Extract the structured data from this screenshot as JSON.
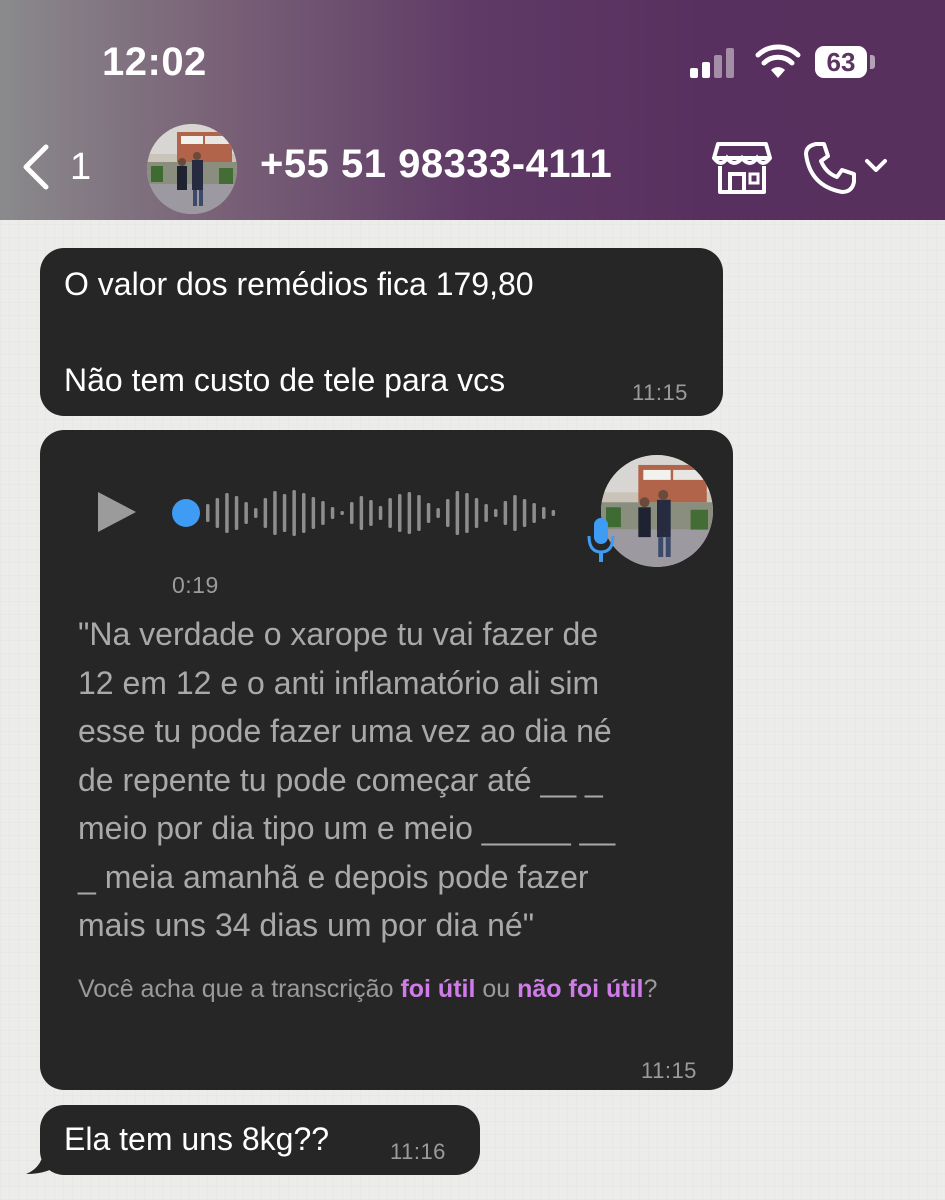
{
  "status_bar": {
    "time": "12:02",
    "battery": "63"
  },
  "header": {
    "back_count": "1",
    "contact": "+55 51 98333-4111"
  },
  "messages": [
    {
      "text": "O valor dos remédios fica 179,80\n\nNão tem custo de tele para vcs",
      "time": "11:15"
    },
    {
      "audio_duration": "0:19",
      "transcript": "\"Na verdade o xarope tu vai fazer de\n12 em 12 e o anti inflamatório ali sim\nesse tu pode fazer uma vez ao dia né\nde repente tu pode começar até __ _\nmeio por dia tipo um e meio _____ __\n_ meia amanhã e depois pode fazer\nmais uns 34 dias um por dia né\"",
      "feedback_prefix": "Você acha que a transcrição ",
      "feedback_yes": "foi útil",
      "feedback_mid": " ou ",
      "feedback_no": "não foi útil",
      "feedback_suffix": "?",
      "time": "11:15"
    },
    {
      "text": "Ela tem uns 8kg??",
      "time": "11:16"
    }
  ],
  "colors": {
    "bubble": "#262626",
    "accent_link": "#cf7ce8",
    "play_dot": "#3f9cf5",
    "header": "#58305f"
  },
  "icons": [
    "back-chevron-icon",
    "store-icon",
    "phone-icon",
    "chevron-down-icon",
    "play-icon",
    "microphone-icon"
  ]
}
